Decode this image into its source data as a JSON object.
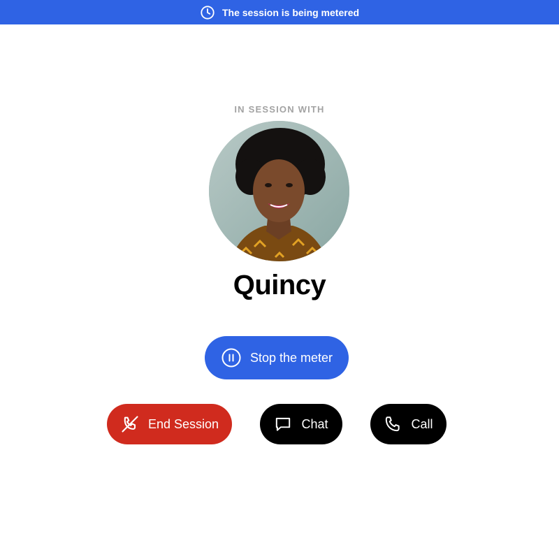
{
  "banner": {
    "text": "The session is being metered",
    "icon": "clock-icon",
    "color": "#2f63e4"
  },
  "session": {
    "eyebrow": "IN SESSION WITH",
    "name": "Quincy",
    "avatar": "profile-photo"
  },
  "actions": {
    "stop_meter": {
      "label": "Stop the meter",
      "icon": "pause-circle-icon",
      "color": "#2f63e4"
    },
    "end_session": {
      "label": "End Session",
      "icon": "phone-off-icon",
      "color": "#d02b1e"
    },
    "chat": {
      "label": "Chat",
      "icon": "chat-bubble-icon",
      "color": "#000000"
    },
    "call": {
      "label": "Call",
      "icon": "phone-icon",
      "color": "#000000"
    }
  }
}
